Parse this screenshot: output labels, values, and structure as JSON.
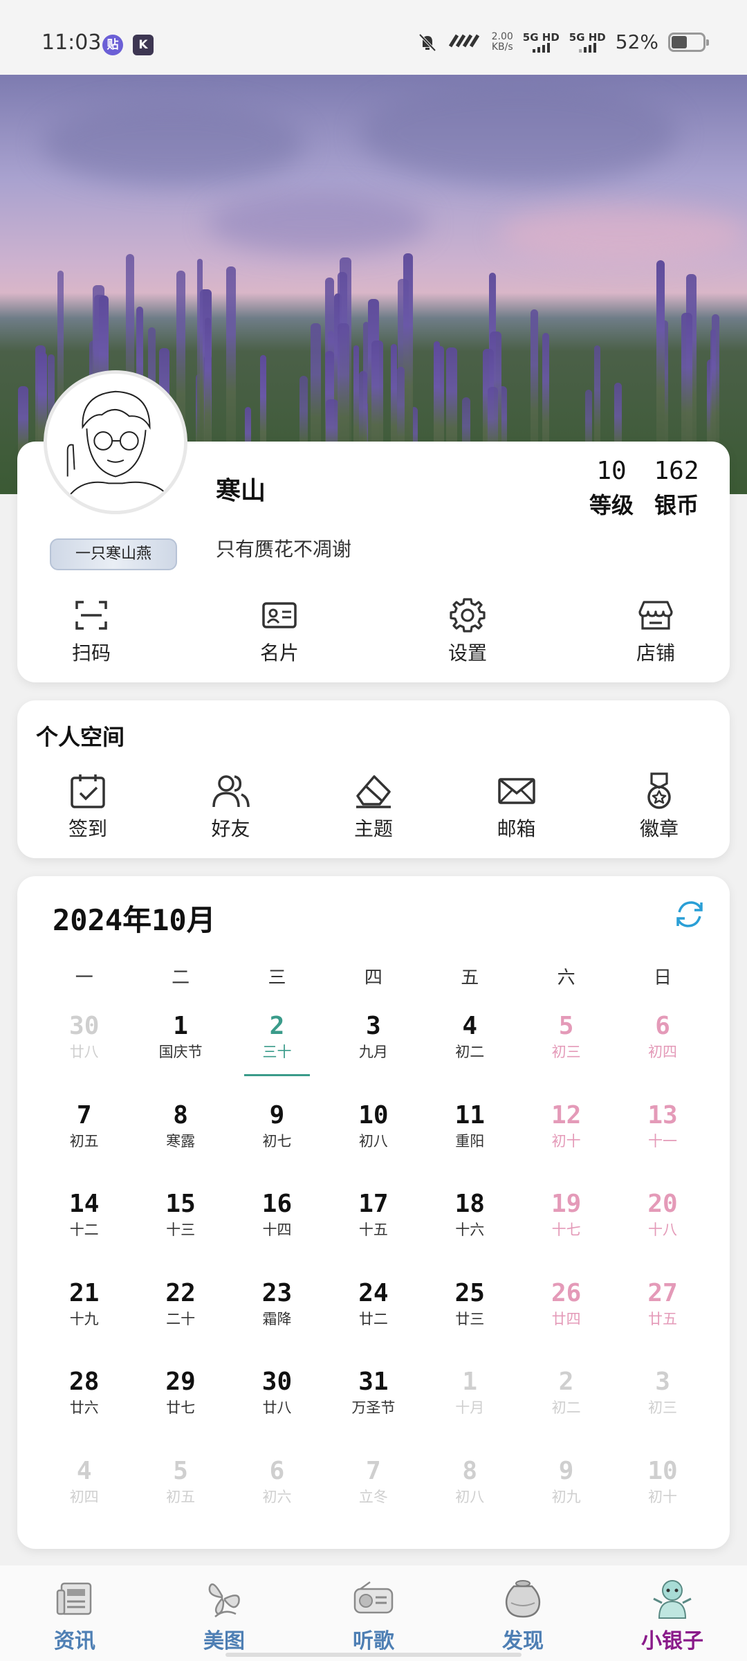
{
  "status_bar": {
    "time": "11:03",
    "app1": "贴",
    "app2": "K",
    "net_speed": "2.00",
    "net_unit": "KB/s",
    "sig1": "5G HD",
    "sig2": "5G HD",
    "battery": "52%",
    "battery_level": 0.52
  },
  "profile": {
    "name": "寒山",
    "signature": "只有赝花不凋谢",
    "nickname_tag": "一只寒山燕",
    "level_value": "10",
    "level_label": "等级",
    "coins_value": "162",
    "coins_label": "银币"
  },
  "quick_actions": [
    "扫码",
    "名片",
    "设置",
    "店铺"
  ],
  "personal_space": {
    "title": "个人空间",
    "items": [
      "签到",
      "好友",
      "主题",
      "邮箱",
      "徽章"
    ]
  },
  "calendar": {
    "title": "2024年10月",
    "weekdays": [
      "一",
      "二",
      "三",
      "四",
      "五",
      "六",
      "日"
    ],
    "days": [
      {
        "d": "30",
        "l": "廿八",
        "type": "other"
      },
      {
        "d": "1",
        "l": "国庆节",
        "type": ""
      },
      {
        "d": "2",
        "l": "三十",
        "type": "today"
      },
      {
        "d": "3",
        "l": "九月",
        "type": ""
      },
      {
        "d": "4",
        "l": "初二",
        "type": ""
      },
      {
        "d": "5",
        "l": "初三",
        "type": "weekend"
      },
      {
        "d": "6",
        "l": "初四",
        "type": "weekend"
      },
      {
        "d": "7",
        "l": "初五",
        "type": ""
      },
      {
        "d": "8",
        "l": "寒露",
        "type": ""
      },
      {
        "d": "9",
        "l": "初七",
        "type": ""
      },
      {
        "d": "10",
        "l": "初八",
        "type": ""
      },
      {
        "d": "11",
        "l": "重阳",
        "type": ""
      },
      {
        "d": "12",
        "l": "初十",
        "type": "weekend"
      },
      {
        "d": "13",
        "l": "十一",
        "type": "weekend"
      },
      {
        "d": "14",
        "l": "十二",
        "type": ""
      },
      {
        "d": "15",
        "l": "十三",
        "type": ""
      },
      {
        "d": "16",
        "l": "十四",
        "type": ""
      },
      {
        "d": "17",
        "l": "十五",
        "type": ""
      },
      {
        "d": "18",
        "l": "十六",
        "type": ""
      },
      {
        "d": "19",
        "l": "十七",
        "type": "weekend"
      },
      {
        "d": "20",
        "l": "十八",
        "type": "weekend"
      },
      {
        "d": "21",
        "l": "十九",
        "type": ""
      },
      {
        "d": "22",
        "l": "二十",
        "type": ""
      },
      {
        "d": "23",
        "l": "霜降",
        "type": ""
      },
      {
        "d": "24",
        "l": "廿二",
        "type": ""
      },
      {
        "d": "25",
        "l": "廿三",
        "type": ""
      },
      {
        "d": "26",
        "l": "廿四",
        "type": "weekend"
      },
      {
        "d": "27",
        "l": "廿五",
        "type": "weekend"
      },
      {
        "d": "28",
        "l": "廿六",
        "type": ""
      },
      {
        "d": "29",
        "l": "廿七",
        "type": ""
      },
      {
        "d": "30",
        "l": "廿八",
        "type": ""
      },
      {
        "d": "31",
        "l": "万圣节",
        "type": ""
      },
      {
        "d": "1",
        "l": "十月",
        "type": "other"
      },
      {
        "d": "2",
        "l": "初二",
        "type": "other"
      },
      {
        "d": "3",
        "l": "初三",
        "type": "other"
      },
      {
        "d": "4",
        "l": "初四",
        "type": "other"
      },
      {
        "d": "5",
        "l": "初五",
        "type": "other"
      },
      {
        "d": "6",
        "l": "初六",
        "type": "other"
      },
      {
        "d": "7",
        "l": "立冬",
        "type": "other"
      },
      {
        "d": "8",
        "l": "初八",
        "type": "other"
      },
      {
        "d": "9",
        "l": "初九",
        "type": "other"
      },
      {
        "d": "10",
        "l": "初十",
        "type": "other"
      }
    ]
  },
  "bottom_nav": [
    {
      "label": "资讯",
      "icon": "newspaper-icon"
    },
    {
      "label": "美图",
      "icon": "butterfly-icon"
    },
    {
      "label": "听歌",
      "icon": "radio-icon"
    },
    {
      "label": "发现",
      "icon": "pot-icon"
    },
    {
      "label": "小银子",
      "icon": "character-icon",
      "active": true
    }
  ],
  "colors": {
    "accent_today": "#3a9b8a",
    "weekend": "#e49ab8",
    "nav_label": "#4e7fb4",
    "nav_active": "#8a1a8a",
    "refresh": "#2a9fd6"
  }
}
